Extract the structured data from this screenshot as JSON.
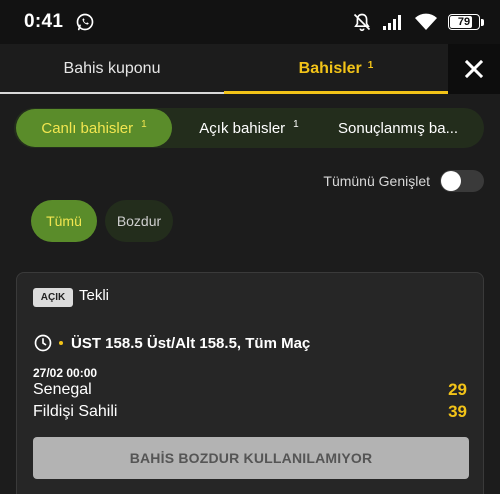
{
  "status_bar": {
    "time": "0:41",
    "battery": "79",
    "battery_level": 0.79,
    "icons": [
      "whatsapp-icon",
      "bell-muted-icon",
      "signal-icon",
      "wifi-icon",
      "battery-icon"
    ]
  },
  "header": {
    "tabs": [
      {
        "label": "Bahis kuponu",
        "badge": ""
      },
      {
        "label": "Bahisler",
        "badge": "1"
      }
    ],
    "close_icon": "close-icon"
  },
  "filters": {
    "canli": {
      "label": "Canlı bahisler",
      "count": "1"
    },
    "acik": {
      "label": "Açık bahisler",
      "count": "1"
    },
    "sonuc": {
      "label": "Sonuçlanmış ba..."
    }
  },
  "expand": {
    "label": "Tümünü Genişlet",
    "on": false
  },
  "chips": {
    "tumu": "Tümü",
    "bozdur": "Bozdur"
  },
  "bet": {
    "badge": "AÇIK",
    "type": "Tekli",
    "market": "ÜST 158.5 Üst/Alt 158.5, Tüm Maç",
    "date": "27/02 00:00",
    "team1": "Senegal",
    "score1": "29",
    "team2": "Fildişi Sahili",
    "score2": "39",
    "cashout_label": "BAHİS BOZDUR KULLANILAMIYOR"
  },
  "colors": {
    "accent": "#f2c318",
    "active_pill": "#5a8c2a",
    "pill_bg": "#232d1c",
    "background": "#1c1c1c"
  }
}
